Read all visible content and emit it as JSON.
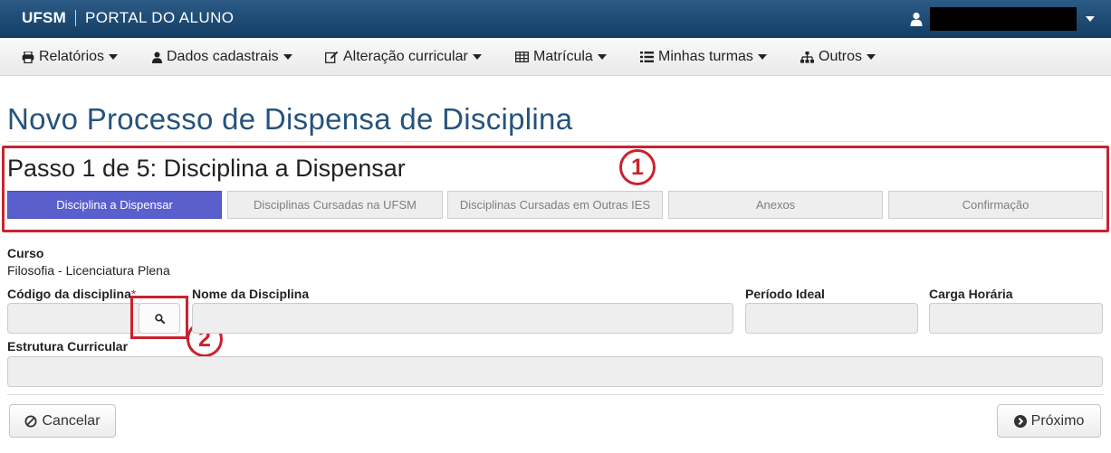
{
  "header": {
    "brand_strong": "UFSM",
    "brand_light": "PORTAL DO ALUNO",
    "user_menu_icon": "user-icon",
    "colors": {
      "topbar": "#1d4a73"
    }
  },
  "menu": {
    "items": [
      {
        "label": "Relatórios",
        "icon": "print-icon"
      },
      {
        "label": "Dados cadastrais",
        "icon": "user-icon"
      },
      {
        "label": "Alteração curricular",
        "icon": "edit-icon"
      },
      {
        "label": "Matrícula",
        "icon": "table-icon"
      },
      {
        "label": "Minhas turmas",
        "icon": "list-icon"
      },
      {
        "label": "Outros",
        "icon": "sitemap-icon"
      }
    ]
  },
  "page": {
    "title": "Novo Processo de Dispensa de Disciplina",
    "title_color": "#26537c"
  },
  "wizard": {
    "step_title": "Passo 1 de 5: Disciplina a Dispensar",
    "tabs": [
      {
        "label": "Disciplina a Dispensar",
        "active": true
      },
      {
        "label": "Disciplinas Cursadas na UFSM",
        "active": false
      },
      {
        "label": "Disciplinas Cursadas em Outras IES",
        "active": false
      },
      {
        "label": "Anexos",
        "active": false
      },
      {
        "label": "Confirmação",
        "active": false
      }
    ],
    "active_color": "#5a5fce"
  },
  "callouts": {
    "one": "1",
    "two": "2",
    "color": "#c9232e"
  },
  "form": {
    "curso_label": "Curso",
    "curso_value": "Filosofia - Licenciatura Plena",
    "codigo_label": "Código da disciplina",
    "required_mark": "*",
    "codigo_value": "",
    "nome_label": "Nome da Disciplina",
    "nome_value": "",
    "periodo_label": "Período Ideal",
    "periodo_value": "",
    "carga_label": "Carga Horária",
    "carga_value": "",
    "estrutura_label": "Estrutura Curricular",
    "estrutura_value": "",
    "search_icon": "search-icon"
  },
  "actions": {
    "cancel_label": "Cancelar",
    "cancel_icon": "ban-icon",
    "next_label": "Próximo",
    "next_icon": "chevron-circle-right-icon"
  }
}
